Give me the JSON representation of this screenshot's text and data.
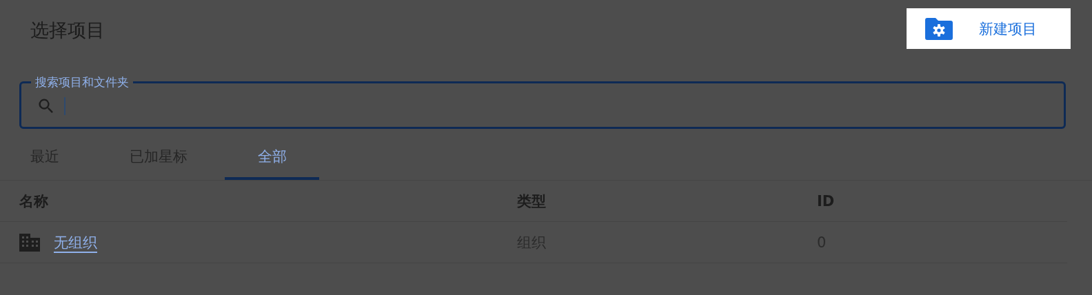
{
  "dialog": {
    "title": "选择项目"
  },
  "new_project_button": {
    "label": "新建项目"
  },
  "search": {
    "label": "搜索项目和文件夹",
    "focused": true
  },
  "tabs": [
    {
      "label": "最近",
      "selected": false
    },
    {
      "label": "已加星标",
      "selected": false
    },
    {
      "label": "全部",
      "selected": true
    }
  ],
  "table": {
    "columns": [
      "名称",
      "类型",
      "ID"
    ],
    "rows": [
      {
        "kind": "organization",
        "name": "无组织",
        "type": "组织",
        "id": "0"
      }
    ]
  }
}
